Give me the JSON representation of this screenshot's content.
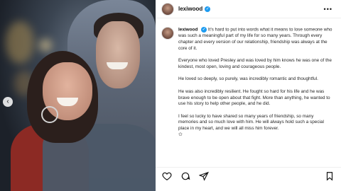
{
  "post": {
    "username": "lexiwood",
    "caption_paragraphs": [
      "It's hard to put into words what it means to lose someone who was such a meaningful part of my life for so many years. Through every chapter and every version of our relationship, friendship was always at the core of it.",
      "Everyone who loved Presley and was loved by him knows he was one of the kindest, most open, loving and courageous people.",
      "He loved so deeply, so purely, was incredibly romantic and thoughtful.",
      "He was also incredibly resilient. He fought so hard for his life and he was brave enough to be open about that fight. More than anything, he wanted to use his story to help other people, and he did.",
      "I feel so lucky to have shared so many years of friendship, so many memories and so much love with him. He will always hold such a special place in my heart, and we will all miss him forever."
    ]
  },
  "icons": {
    "verified": "verified-badge-icon",
    "more": "more-options-icon",
    "prev": "chevron-left-icon",
    "like": "heart-icon",
    "comment": "comment-icon",
    "share": "send-icon",
    "save": "bookmark-icon"
  },
  "colors": {
    "verified": "#1d9bf0"
  }
}
